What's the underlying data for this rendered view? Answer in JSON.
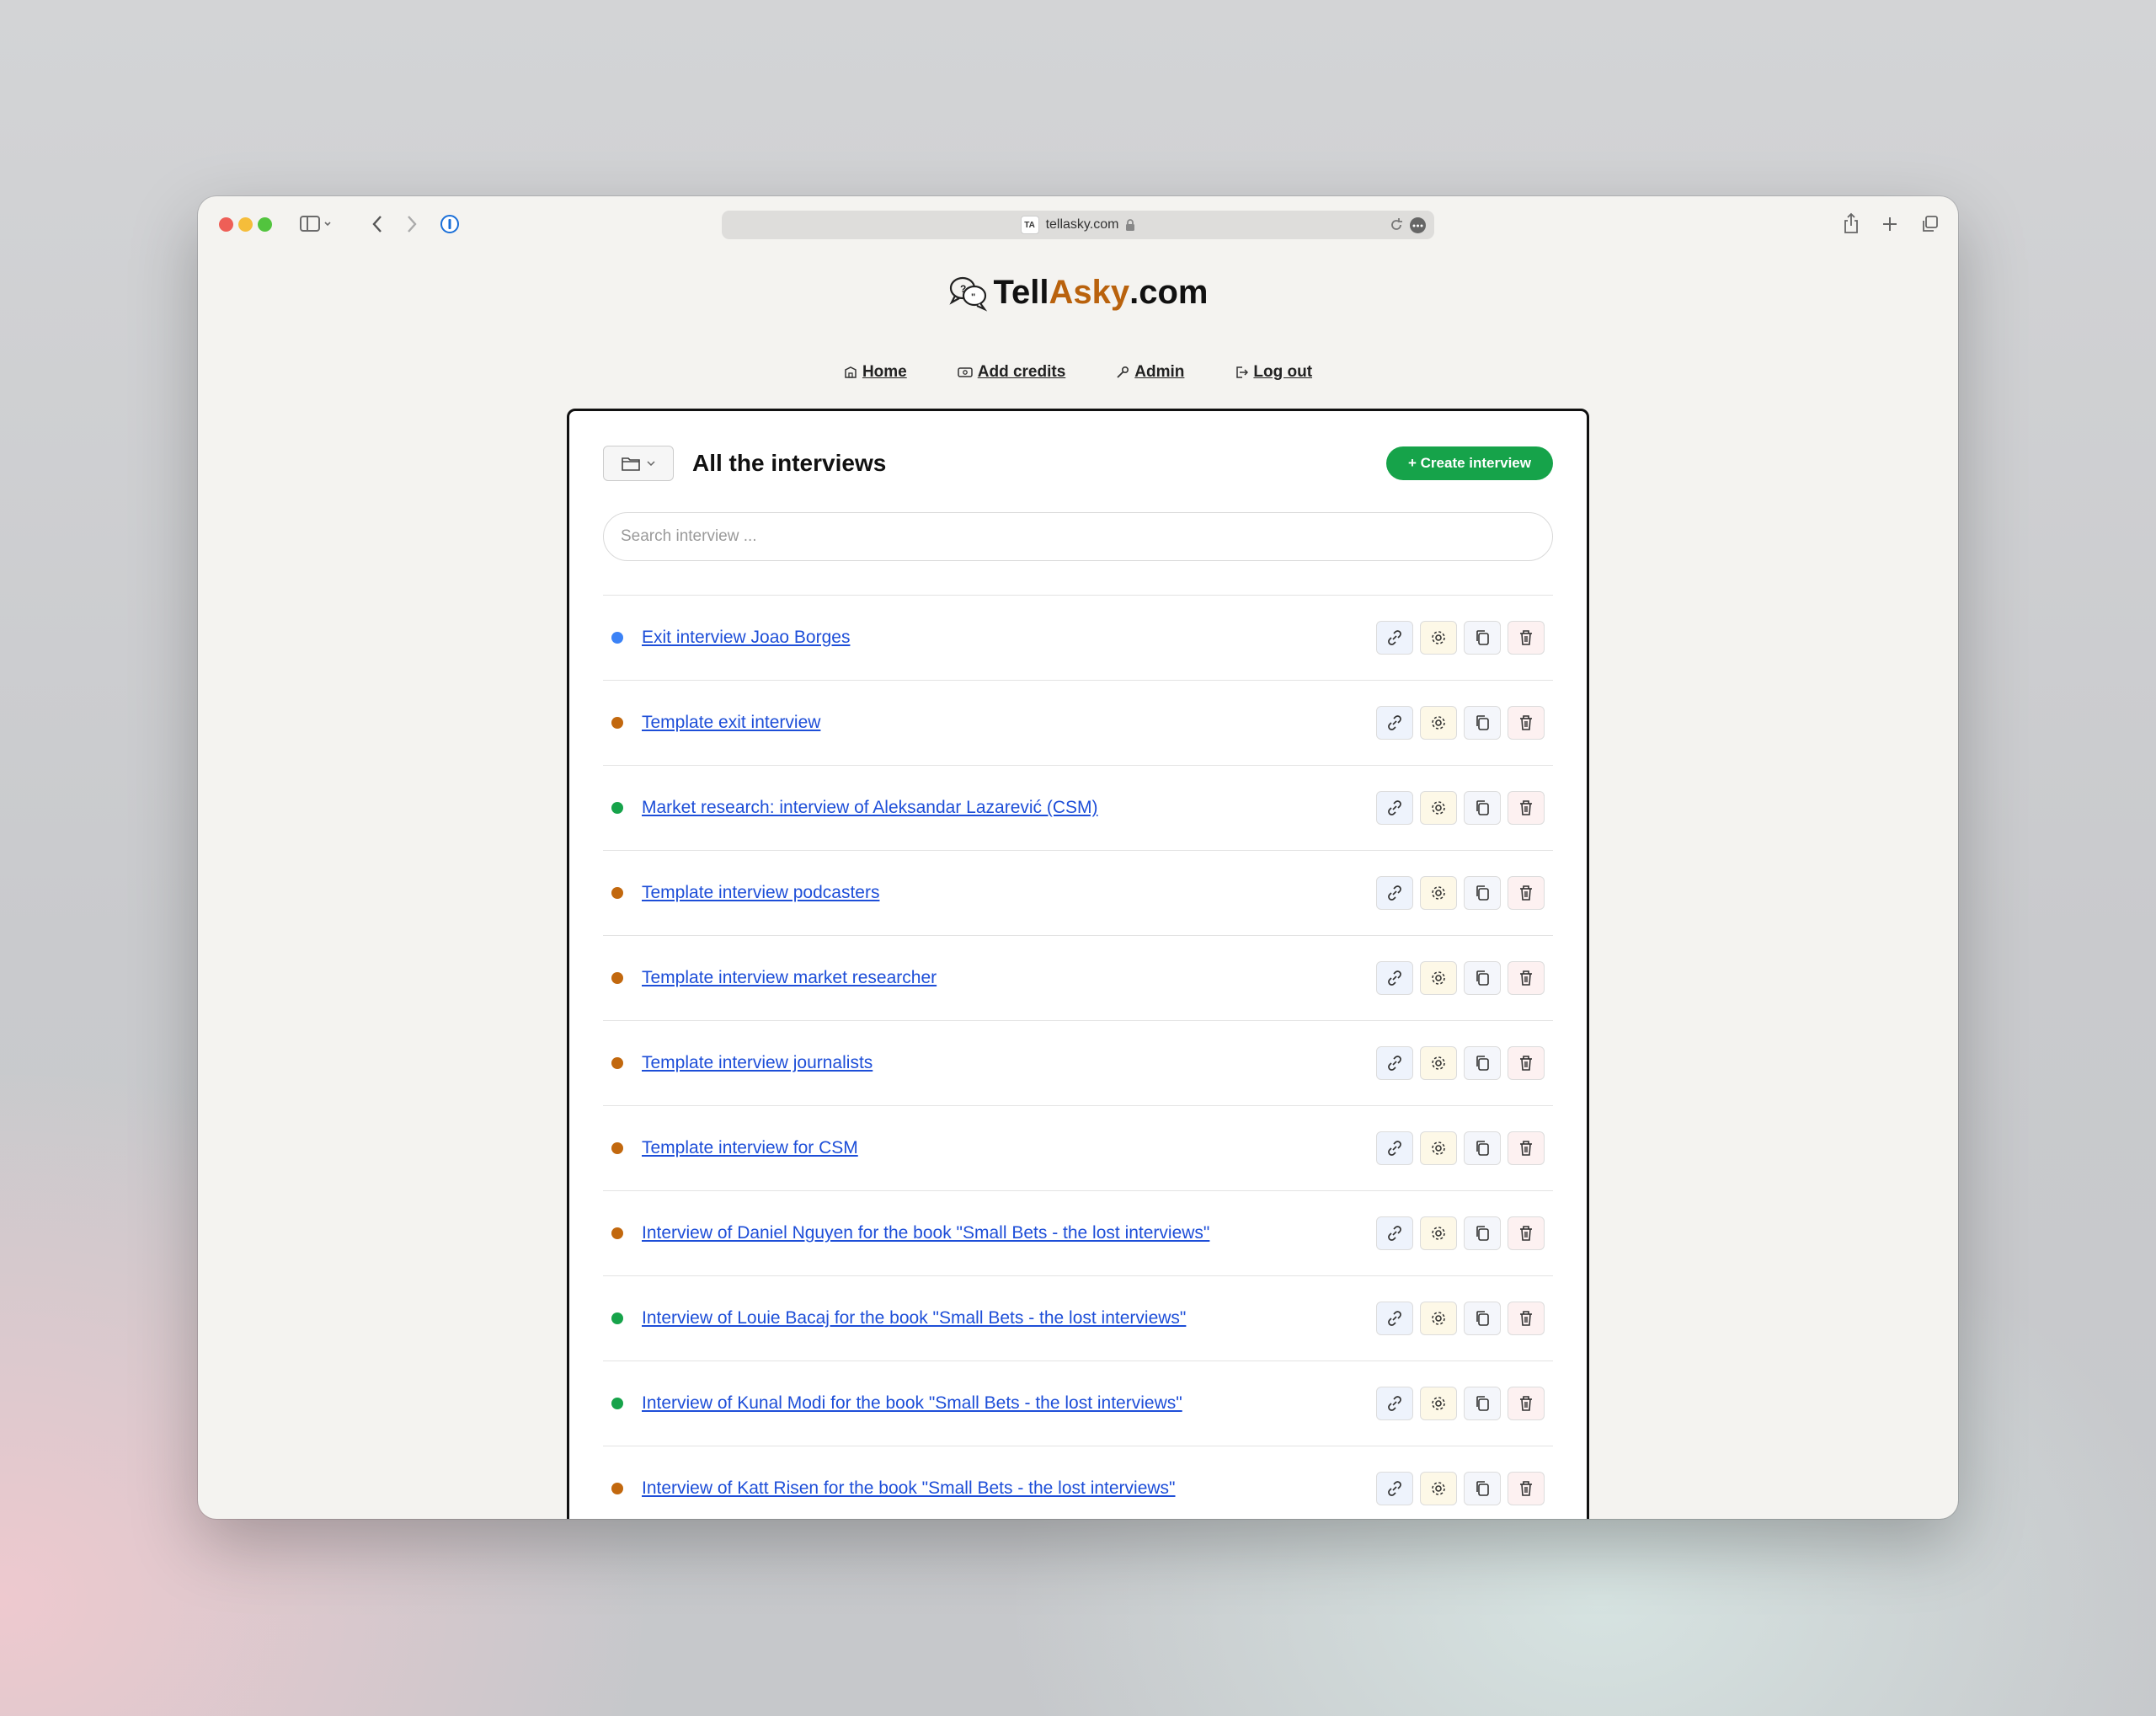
{
  "browser": {
    "url": "tellasky.com",
    "favicon_text": "TA"
  },
  "logo": {
    "part1": "Tell",
    "part2": "Asky",
    "part3": ".com"
  },
  "nav": {
    "home": "Home",
    "add_credits": "Add credits",
    "admin": "Admin",
    "logout": "Log out"
  },
  "page": {
    "title": "All the interviews",
    "create_button": "+ Create interview",
    "search_placeholder": "Search interview ..."
  },
  "colors": {
    "blue": "#3b82f6",
    "orange": "#c2680e",
    "green": "#16a34a",
    "create_button": "#16a34a"
  },
  "interviews": [
    {
      "title": "Exit interview Joao Borges",
      "status": "blue"
    },
    {
      "title": "Template exit interview",
      "status": "orange"
    },
    {
      "title": "Market research: interview of Aleksandar Lazarević (CSM)",
      "status": "green"
    },
    {
      "title": "Template interview podcasters",
      "status": "orange"
    },
    {
      "title": "Template interview market researcher",
      "status": "orange"
    },
    {
      "title": "Template interview journalists",
      "status": "orange"
    },
    {
      "title": "Template interview for CSM",
      "status": "orange"
    },
    {
      "title": "Interview of Daniel Nguyen for the book \"Small Bets - the lost interviews\"",
      "status": "orange"
    },
    {
      "title": "Interview of Louie Bacaj for the book \"Small Bets - the lost interviews\"",
      "status": "green"
    },
    {
      "title": "Interview of Kunal Modi for the book \"Small Bets - the lost interviews\"",
      "status": "green"
    },
    {
      "title": "Interview of Katt Risen for the book \"Small Bets - the lost interviews\"",
      "status": "orange"
    }
  ],
  "row_actions": [
    "link-icon",
    "gear-icon",
    "copy-icon",
    "trash-icon"
  ]
}
